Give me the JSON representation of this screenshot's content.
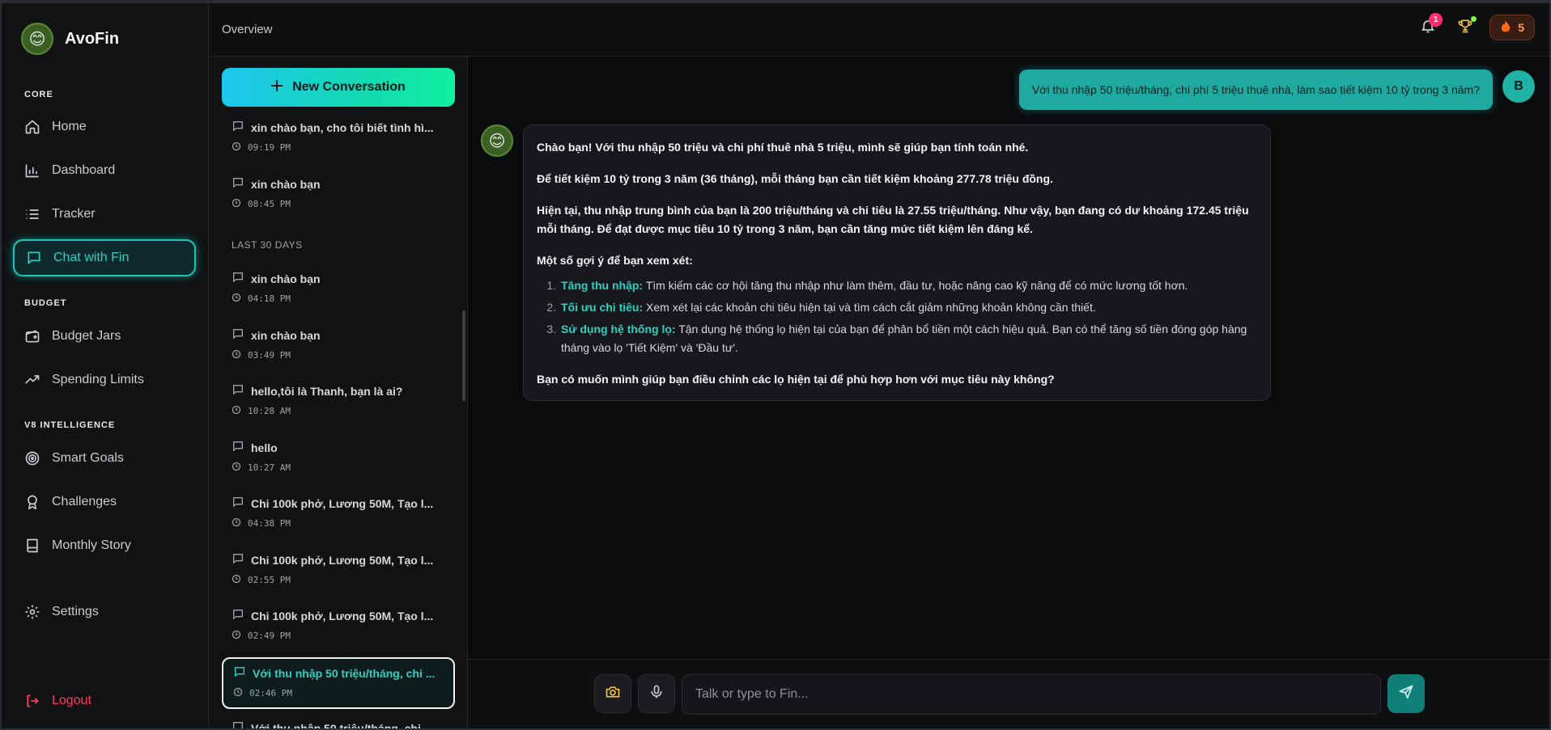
{
  "app": {
    "name": "AvoFin",
    "logo_emoji": "😊"
  },
  "sidebar": {
    "sections": [
      {
        "label": "CORE"
      },
      {
        "label": "BUDGET"
      },
      {
        "label": "V8 INTELLIGENCE"
      }
    ],
    "items": [
      {
        "label": "Home",
        "icon": "home-icon"
      },
      {
        "label": "Dashboard",
        "icon": "bar-chart-icon"
      },
      {
        "label": "Tracker",
        "icon": "list-icon"
      },
      {
        "label": "Chat with Fin",
        "icon": "chat-icon",
        "active": true
      },
      {
        "label": "Budget Jars",
        "icon": "wallet-icon"
      },
      {
        "label": "Spending Limits",
        "icon": "trending-up-icon"
      },
      {
        "label": "Smart Goals",
        "icon": "target-icon"
      },
      {
        "label": "Challenges",
        "icon": "award-icon"
      },
      {
        "label": "Monthly Story",
        "icon": "book-icon"
      },
      {
        "label": "Settings",
        "icon": "gear-icon"
      }
    ],
    "logout_label": "Logout"
  },
  "header": {
    "breadcrumb": "Overview",
    "notification_count": "1",
    "streak_count": "5"
  },
  "conversations": {
    "new_button_label": "New Conversation",
    "group_label": "LAST 30 DAYS",
    "items": [
      {
        "title": "xin chào bạn, cho tôi biết tình hì...",
        "time": "09:19 PM"
      },
      {
        "title": "xin chào bạn",
        "time": "08:45 PM"
      },
      {
        "title": "xin chào bạn",
        "time": "04:18 PM"
      },
      {
        "title": "xin chào bạn",
        "time": "03:49 PM"
      },
      {
        "title": "hello,tôi là Thanh, bạn là ai?",
        "time": "10:28 AM"
      },
      {
        "title": "hello",
        "time": "10:27 AM"
      },
      {
        "title": "Chi 100k phở, Lương 50M, Tạo l...",
        "time": "04:38 PM"
      },
      {
        "title": "Chi 100k phở, Lương 50M, Tạo l...",
        "time": "02:55 PM"
      },
      {
        "title": "Chi 100k phở, Lương 50M, Tạo l...",
        "time": "02:49 PM"
      },
      {
        "title": "Với thu nhập 50 triệu/tháng, chi ...",
        "time": "02:46 PM",
        "active": true
      },
      {
        "title": "Với thu nhập 50 triệu/tháng, chi ...",
        "time": ""
      }
    ]
  },
  "chat": {
    "user_message": "Với thu nhập 50 triệu/tháng, chi phí 5 triệu thuê nhà, làm sao tiết kiệm 10 tỷ trong 3 năm?",
    "user_initial": "B",
    "bot_avatar_emoji": "😊",
    "bot_reply": {
      "p1": "Chào bạn! Với thu nhập 50 triệu và chi phí thuê nhà 5 triệu, mình sẽ giúp bạn tính toán nhé.",
      "p2": "Để tiết kiệm 10 tỷ trong 3 năm (36 tháng), mỗi tháng bạn cần tiết kiệm khoảng 277.78 triệu đồng.",
      "p3": "Hiện tại, thu nhập trung bình của bạn là 200 triệu/tháng và chi tiêu là 27.55 triệu/tháng. Như vậy, bạn đang có dư khoảng 172.45 triệu mỗi tháng. Để đạt được mục tiêu 10 tỷ trong 3 năm, bạn cần tăng mức tiết kiệm lên đáng kể.",
      "p4": "Một số gợi ý để bạn xem xét:",
      "list": [
        {
          "title": "Tăng thu nhập:",
          "text": " Tìm kiếm các cơ hội tăng thu nhập như làm thêm, đầu tư, hoặc nâng cao kỹ năng để có mức lương tốt hơn."
        },
        {
          "title": "Tối ưu chi tiêu:",
          "text": " Xem xét lại các khoản chi tiêu hiện tại và tìm cách cắt giảm những khoản không cần thiết."
        },
        {
          "title": "Sử dụng hệ thống lọ:",
          "text": " Tận dụng hệ thống lọ hiện tại của bạn để phân bổ tiền một cách hiệu quả. Bạn có thể tăng số tiền đóng góp hàng tháng vào lọ 'Tiết Kiệm' và 'Đầu tư'."
        }
      ],
      "p5": "Bạn có muốn mình giúp bạn điều chỉnh các lọ hiện tại để phù hợp hơn với mục tiêu này không?"
    },
    "input_placeholder": "Talk or type to Fin..."
  },
  "colors": {
    "accent": "#16c8b8",
    "danger": "#ff3b5c",
    "badge": "#ff2d6f"
  }
}
